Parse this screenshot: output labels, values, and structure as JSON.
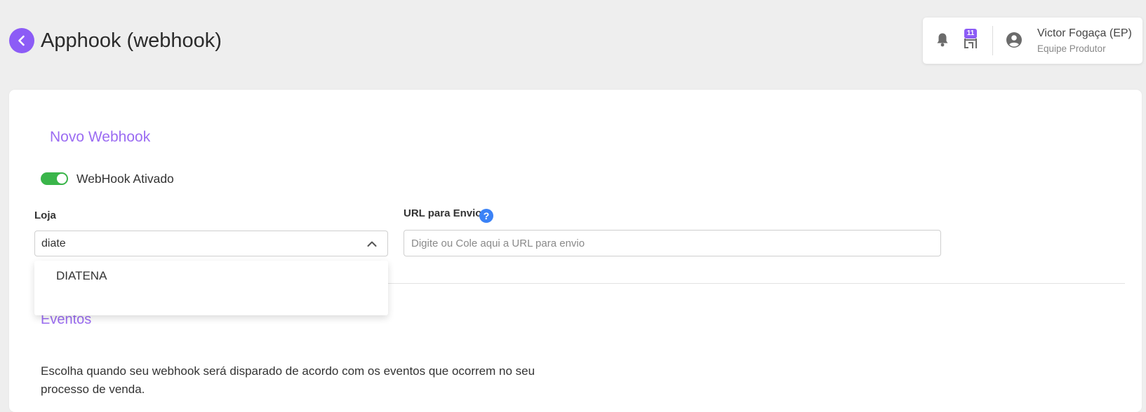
{
  "header": {
    "title": "Apphook (webhook)"
  },
  "user_panel": {
    "store_badge": "11",
    "user_name": "Victor Fogaça (EP)",
    "user_role": "Equipe Produtor"
  },
  "form": {
    "section_title": "Novo Webhook",
    "toggle": {
      "label": "WebHook Ativado",
      "checked": true
    },
    "loja": {
      "label": "Loja",
      "value": "diate",
      "options": [
        "DIATENA"
      ]
    },
    "url": {
      "label": "URL para Envio",
      "help": "?",
      "placeholder": "Digite ou Cole aqui a URL para envio",
      "value": ""
    }
  },
  "events": {
    "title": "Eventos",
    "description": "Escolha quando seu webhook será disparado de acordo com os eventos que ocorrem no seu processo de venda."
  },
  "colors": {
    "accent": "#8c5cf6",
    "toggle_on": "#3ab54a",
    "help_blue": "#3b82f6"
  },
  "icons": [
    "back-icon",
    "bell-icon",
    "store-icon",
    "account-icon",
    "help-icon",
    "chevron-up-icon"
  ]
}
